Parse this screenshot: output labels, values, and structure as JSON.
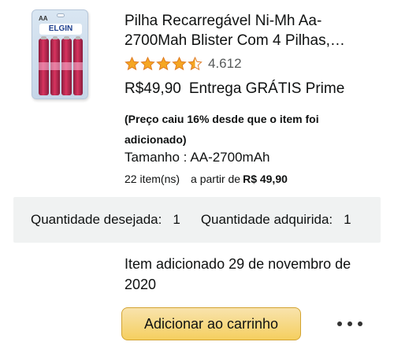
{
  "product": {
    "image_text": {
      "size_tag": "AA",
      "brand": "ELGIN"
    },
    "title_lines": [
      "Pilha Recarregável Ni-Mh Aa-",
      "2700Mah Blister Com 4 Pilhas,…"
    ],
    "rating": {
      "stars": 4.5,
      "count": "4.612"
    },
    "price": "R$49,90",
    "delivery": "Entrega GRÁTIS Prime",
    "price_drop_lines": [
      "(Preço caiu 16% desde que o item foi",
      "adicionado)"
    ],
    "size_label": "Tamanho :",
    "size_value": "AA-2700mAh",
    "offers": {
      "count": "22 item(ns)",
      "from": "a partir de",
      "price": "R$ 49,90"
    }
  },
  "quantity": {
    "desired_label": "Quantidade desejada:",
    "desired_value": "1",
    "acquired_label": "Quantidade adquirida:",
    "acquired_value": "1"
  },
  "added_date_lines": [
    "Item adicionado 29 de novembro de",
    "2020"
  ],
  "actions": {
    "add_to_cart": "Adicionar ao carrinho",
    "more_icon": "more-horizontal-icon"
  },
  "colors": {
    "star": "#f5a623",
    "button": "#f7ca4e",
    "panel": "#f0f2f2",
    "text": "#0f1111",
    "muted": "#565959"
  }
}
